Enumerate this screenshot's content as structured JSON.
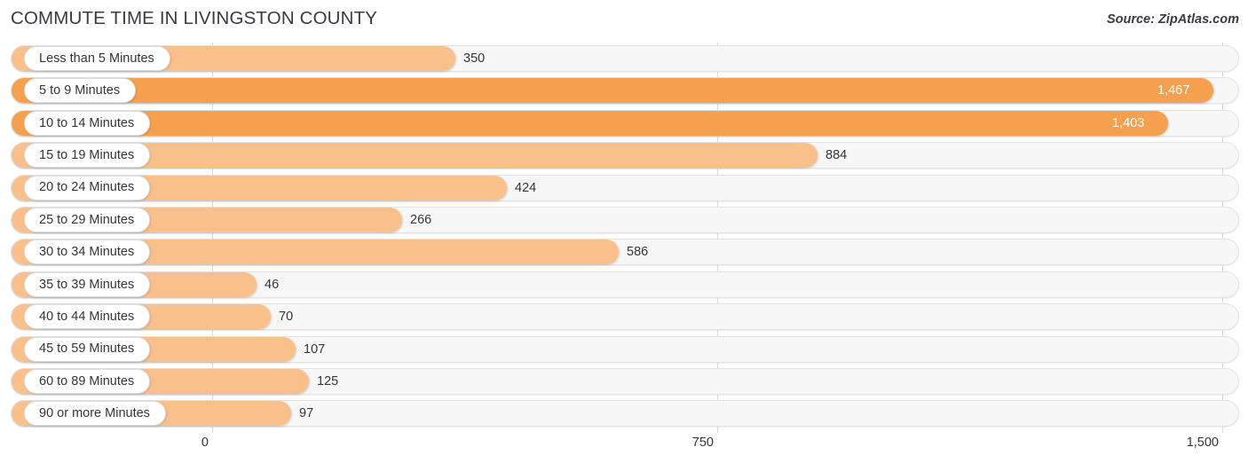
{
  "header": {
    "title": "COMMUTE TIME IN LIVINGSTON COUNTY",
    "source": "Source: ZipAtlas.com"
  },
  "colors": {
    "bar_strong": "#f5a04e",
    "bar_light": "#f9c08c",
    "track": "#f7f7f8",
    "gridline": "#d8d8dc",
    "text": "#33333a",
    "value_inside": "#ffffff"
  },
  "chart_data": {
    "type": "bar",
    "orientation": "horizontal",
    "title": "COMMUTE TIME IN LIVINGSTON COUNTY",
    "xlabel": "",
    "ylabel": "",
    "xlim": [
      0,
      1500
    ],
    "grid": true,
    "legend": null,
    "xticks": [
      "0",
      "750",
      "1,500"
    ],
    "xtick_values": [
      0,
      750,
      1500
    ],
    "categories": [
      "Less than 5 Minutes",
      "5 to 9 Minutes",
      "10 to 14 Minutes",
      "15 to 19 Minutes",
      "20 to 24 Minutes",
      "25 to 29 Minutes",
      "30 to 34 Minutes",
      "35 to 39 Minutes",
      "40 to 44 Minutes",
      "45 to 59 Minutes",
      "60 to 89 Minutes",
      "90 or more Minutes"
    ],
    "values": [
      350,
      1467,
      1403,
      884,
      424,
      266,
      586,
      46,
      70,
      107,
      125,
      97
    ],
    "value_labels": [
      "350",
      "1,467",
      "1,403",
      "884",
      "424",
      "266",
      "586",
      "46",
      "70",
      "107",
      "125",
      "97"
    ]
  },
  "rows": [
    {
      "label": "Less than 5 Minutes",
      "value": 350,
      "value_label": "350",
      "bar_end": 512,
      "style": "light",
      "inside": false
    },
    {
      "label": "5 to 9 Minutes",
      "value": 1467,
      "value_label": "1,467",
      "bar_end": 1366,
      "style": "strong",
      "inside": true
    },
    {
      "label": "10 to 14 Minutes",
      "value": 1403,
      "value_label": "1,403",
      "bar_end": 1315,
      "style": "strong",
      "inside": true
    },
    {
      "label": "15 to 19 Minutes",
      "value": 884,
      "value_label": "884",
      "bar_end": 920,
      "style": "light",
      "inside": false
    },
    {
      "label": "20 to 24 Minutes",
      "value": 424,
      "value_label": "424",
      "bar_end": 570,
      "style": "light",
      "inside": false
    },
    {
      "label": "25 to 29 Minutes",
      "value": 266,
      "value_label": "266",
      "bar_end": 452,
      "style": "light",
      "inside": false
    },
    {
      "label": "30 to 34 Minutes",
      "value": 586,
      "value_label": "586",
      "bar_end": 696,
      "style": "light",
      "inside": false
    },
    {
      "label": "35 to 39 Minutes",
      "value": 46,
      "value_label": "46",
      "bar_end": 288,
      "style": "light",
      "inside": false
    },
    {
      "label": "40 to 44 Minutes",
      "value": 70,
      "value_label": "70",
      "bar_end": 304,
      "style": "light",
      "inside": false
    },
    {
      "label": "45 to 59 Minutes",
      "value": 107,
      "value_label": "107",
      "bar_end": 332,
      "style": "light",
      "inside": false
    },
    {
      "label": "60 to 89 Minutes",
      "value": 125,
      "value_label": "125",
      "bar_end": 347,
      "style": "light",
      "inside": false
    },
    {
      "label": "90 or more Minutes",
      "value": 97,
      "value_label": "97",
      "bar_end": 327,
      "style": "light",
      "inside": false
    }
  ],
  "axis": {
    "ticks": [
      {
        "label": "0",
        "x": 239
      },
      {
        "label": "750",
        "x": 808
      },
      {
        "label": "1,500",
        "x": 1377
      }
    ]
  }
}
